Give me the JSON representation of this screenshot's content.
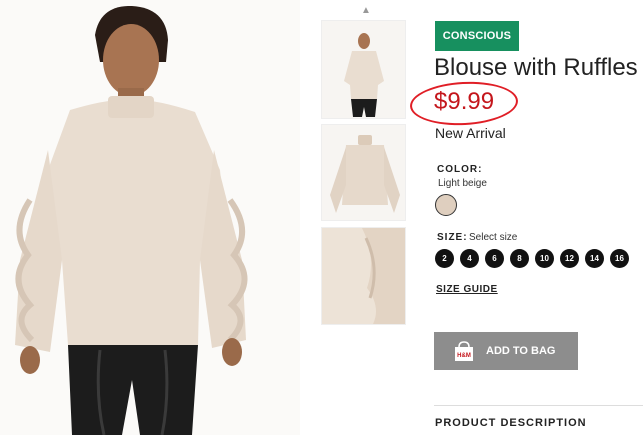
{
  "product": {
    "badge": "CONSCIOUS",
    "title": "Blouse with Ruffles",
    "price": "$9.99",
    "status": "New Arrival"
  },
  "color": {
    "label": "COLOR:",
    "value": "Light beige",
    "swatch_color": "#dfcfbf"
  },
  "size": {
    "label": "SIZE:",
    "prompt": "Select size",
    "options": [
      "2",
      "4",
      "6",
      "8",
      "10",
      "12",
      "14",
      "16"
    ]
  },
  "size_guide_label": "SIZE GUIDE",
  "add_to_bag": {
    "label": "ADD TO BAG",
    "icon_text": "H&M"
  },
  "description_title": "PRODUCT DESCRIPTION",
  "icons": {
    "thumbnail_scroll_up": "chevron-up-icon",
    "bag": "shopping-bag-icon"
  },
  "colors": {
    "badge_green": "#17905f",
    "price_red": "#c4161c",
    "highlight_circle": "#e01e26",
    "button_gray": "#8d8d8d"
  }
}
